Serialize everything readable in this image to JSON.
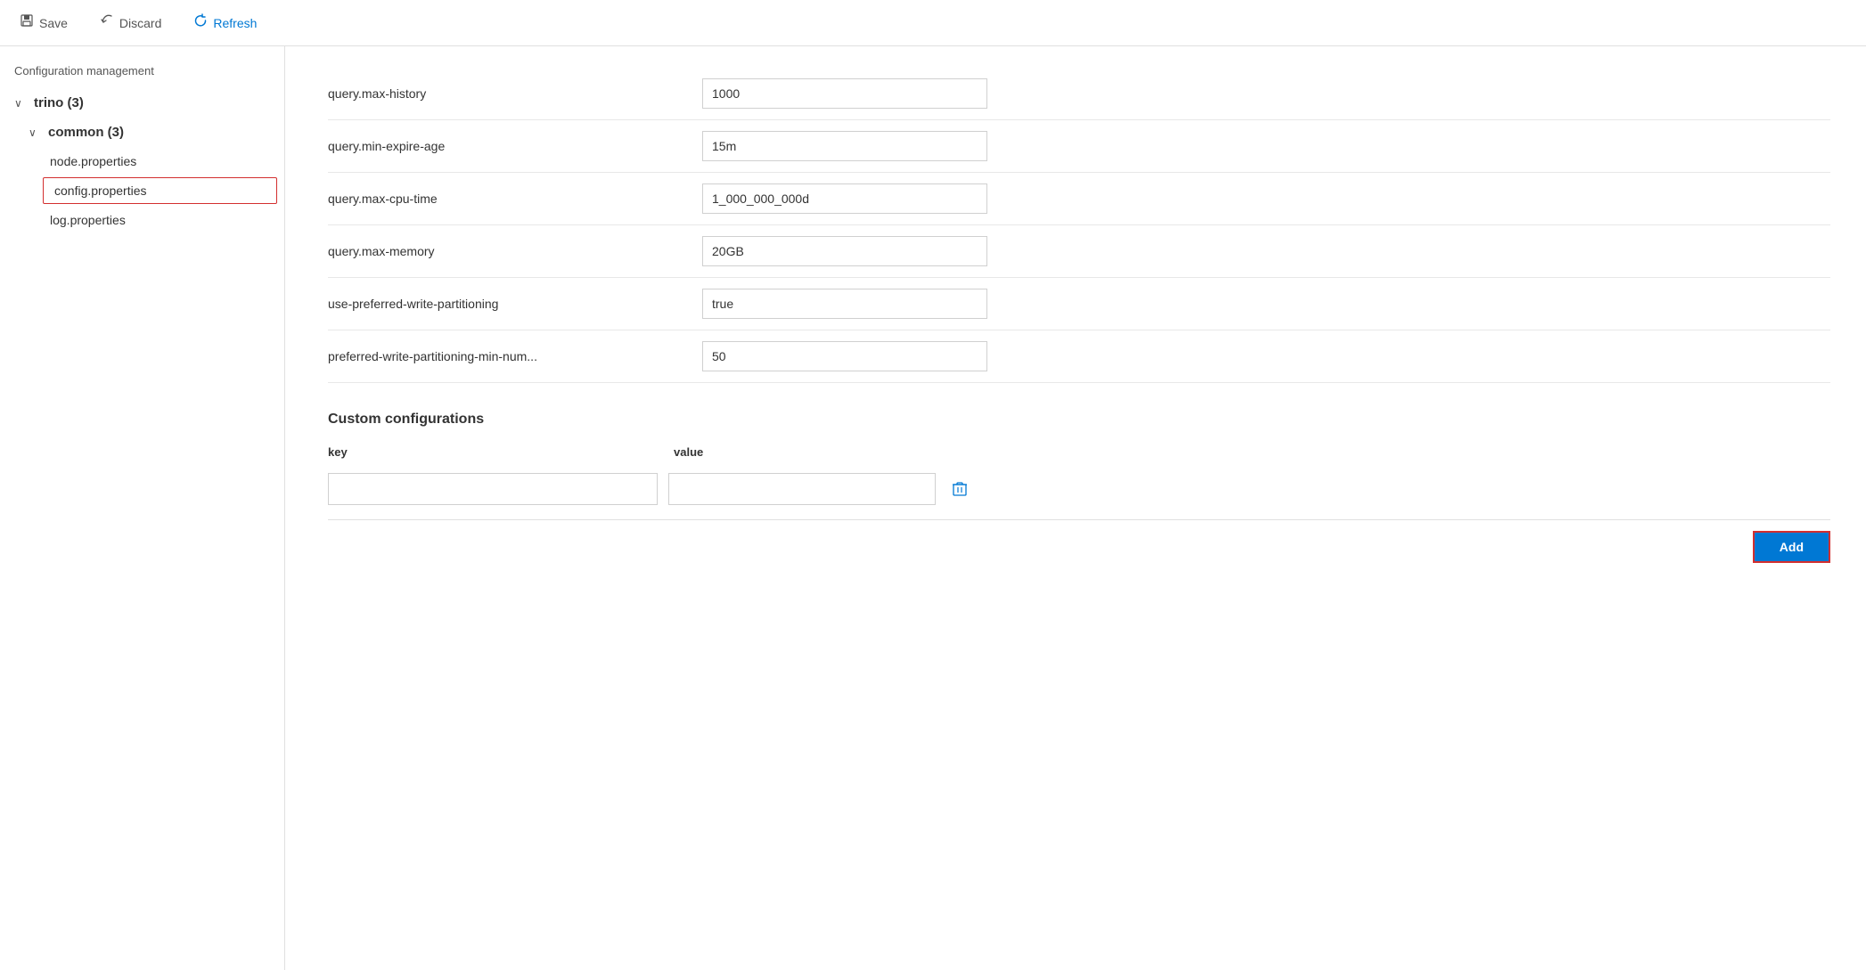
{
  "toolbar": {
    "save_label": "Save",
    "discard_label": "Discard",
    "refresh_label": "Refresh"
  },
  "sidebar": {
    "title": "Configuration management",
    "tree": {
      "root_label": "trino (3)",
      "root_count": 3,
      "children": [
        {
          "label": "common (3)",
          "count": 3,
          "children": [
            {
              "label": "node.properties",
              "selected": false
            },
            {
              "label": "config.properties",
              "selected": true
            },
            {
              "label": "log.properties",
              "selected": false
            }
          ]
        }
      ]
    }
  },
  "config_rows": [
    {
      "key": "query.max-history",
      "value": "1000"
    },
    {
      "key": "query.min-expire-age",
      "value": "15m"
    },
    {
      "key": "query.max-cpu-time",
      "value": "1_000_000_000d"
    },
    {
      "key": "query.max-memory",
      "value": "20GB"
    },
    {
      "key": "use-preferred-write-partitioning",
      "value": "true"
    },
    {
      "key": "preferred-write-partitioning-min-num...",
      "value": "50"
    }
  ],
  "custom_config": {
    "title": "Custom configurations",
    "col_key": "key",
    "col_value": "value",
    "rows": [
      {
        "key": "",
        "value": ""
      }
    ]
  },
  "add_button_label": "Add",
  "icons": {
    "save": "💾",
    "discard": "↩",
    "refresh": "↺",
    "chevron_down": "∨",
    "delete": "🗑"
  }
}
